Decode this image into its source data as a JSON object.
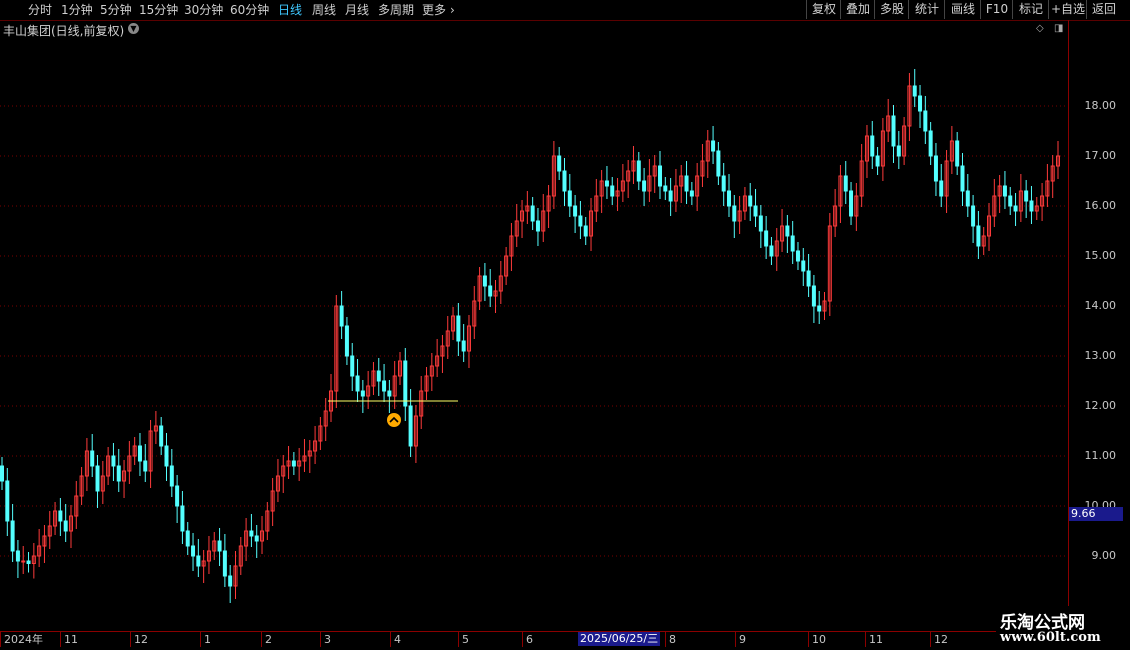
{
  "toolbar": {
    "periods": [
      "分时",
      "1分钟",
      "5分钟",
      "15分钟",
      "30分钟",
      "60分钟",
      "日线",
      "周线",
      "月线",
      "多周期",
      "更多"
    ],
    "active_period": "日线",
    "tools": [
      "复权",
      "叠加",
      "多股",
      "统计",
      "画线",
      "F10",
      "标记",
      "+自选",
      "返回"
    ]
  },
  "chart_title": "丰山集团(日线,前复权)",
  "current_price_label": "9.66",
  "cursor_date": "2025/06/25/三",
  "watermark": {
    "line1": "乐淘公式网",
    "line2": "www.60lt.com"
  },
  "colors": {
    "up": "#ff3b3b",
    "down": "#54ffff",
    "grid": "#7a0000",
    "support": "#ffff66",
    "marker": "#ffaa00"
  },
  "chart_data": {
    "type": "candlestick",
    "title": "丰山集团(日线,前复权)",
    "y_ticks": [
      9.0,
      10.0,
      11.0,
      12.0,
      13.0,
      14.0,
      15.0,
      16.0,
      17.0,
      18.0
    ],
    "y_tick_labels": [
      "9.00",
      "10.00",
      "11.00",
      "12.00",
      "13.00",
      "14.00",
      "15.00",
      "16.00",
      "17.00",
      "18.00"
    ],
    "ylim": [
      8.0,
      19.3
    ],
    "x_labels": [
      "2024年",
      "11",
      "12",
      "1",
      "2",
      "3",
      "4",
      "5",
      "6",
      "2025/06/25/三",
      "8",
      "9",
      "10",
      "11",
      "12"
    ],
    "support_level": 12.1,
    "marker_price": 11.72,
    "close_series": [
      10.5,
      9.7,
      9.1,
      8.9,
      8.9,
      8.85,
      9.0,
      9.2,
      9.4,
      9.6,
      9.9,
      9.7,
      9.5,
      9.8,
      10.2,
      10.6,
      11.1,
      10.8,
      10.3,
      10.6,
      11.0,
      10.8,
      10.5,
      10.7,
      11.0,
      11.2,
      10.9,
      10.7,
      11.5,
      11.6,
      11.2,
      10.8,
      10.4,
      10.0,
      9.5,
      9.2,
      9.0,
      8.8,
      8.9,
      9.1,
      9.3,
      9.1,
      8.6,
      8.4,
      8.8,
      9.2,
      9.5,
      9.4,
      9.3,
      9.5,
      9.9,
      10.3,
      10.6,
      10.8,
      10.9,
      10.8,
      10.9,
      11.0,
      11.1,
      11.3,
      11.6,
      11.9,
      12.3,
      14.0,
      13.6,
      13.0,
      12.6,
      12.3,
      12.2,
      12.4,
      12.7,
      12.5,
      12.3,
      12.2,
      12.6,
      12.9,
      12.0,
      11.2,
      11.8,
      12.3,
      12.6,
      12.8,
      13.0,
      13.2,
      13.5,
      13.8,
      13.3,
      13.1,
      13.6,
      14.1,
      14.6,
      14.4,
      14.2,
      14.3,
      14.6,
      15.0,
      15.4,
      15.7,
      15.9,
      16.0,
      15.7,
      15.5,
      15.9,
      16.2,
      17.0,
      16.7,
      16.3,
      16.0,
      15.8,
      15.6,
      15.4,
      15.9,
      16.2,
      16.5,
      16.4,
      16.2,
      16.3,
      16.5,
      16.7,
      16.9,
      16.5,
      16.3,
      16.6,
      16.8,
      16.4,
      16.3,
      16.1,
      16.4,
      16.6,
      16.3,
      16.2,
      16.6,
      16.9,
      17.3,
      17.1,
      16.6,
      16.3,
      16.0,
      15.7,
      15.9,
      16.2,
      16.0,
      15.8,
      15.5,
      15.2,
      15.0,
      15.3,
      15.6,
      15.4,
      15.1,
      14.9,
      14.7,
      14.4,
      14.0,
      13.9,
      14.1,
      15.6,
      16.0,
      16.6,
      16.3,
      15.8,
      16.2,
      16.9,
      17.4,
      17.0,
      16.8,
      17.5,
      17.8,
      17.2,
      17.0,
      17.6,
      18.4,
      18.2,
      17.9,
      17.5,
      17.0,
      16.5,
      16.2,
      16.9,
      17.3,
      16.8,
      16.3,
      16.0,
      15.6,
      15.2,
      15.4,
      15.8,
      16.2,
      16.4,
      16.2,
      16.0,
      15.9,
      16.3,
      16.1,
      15.9,
      16.0,
      16.2,
      16.5,
      16.8,
      17.0
    ]
  }
}
